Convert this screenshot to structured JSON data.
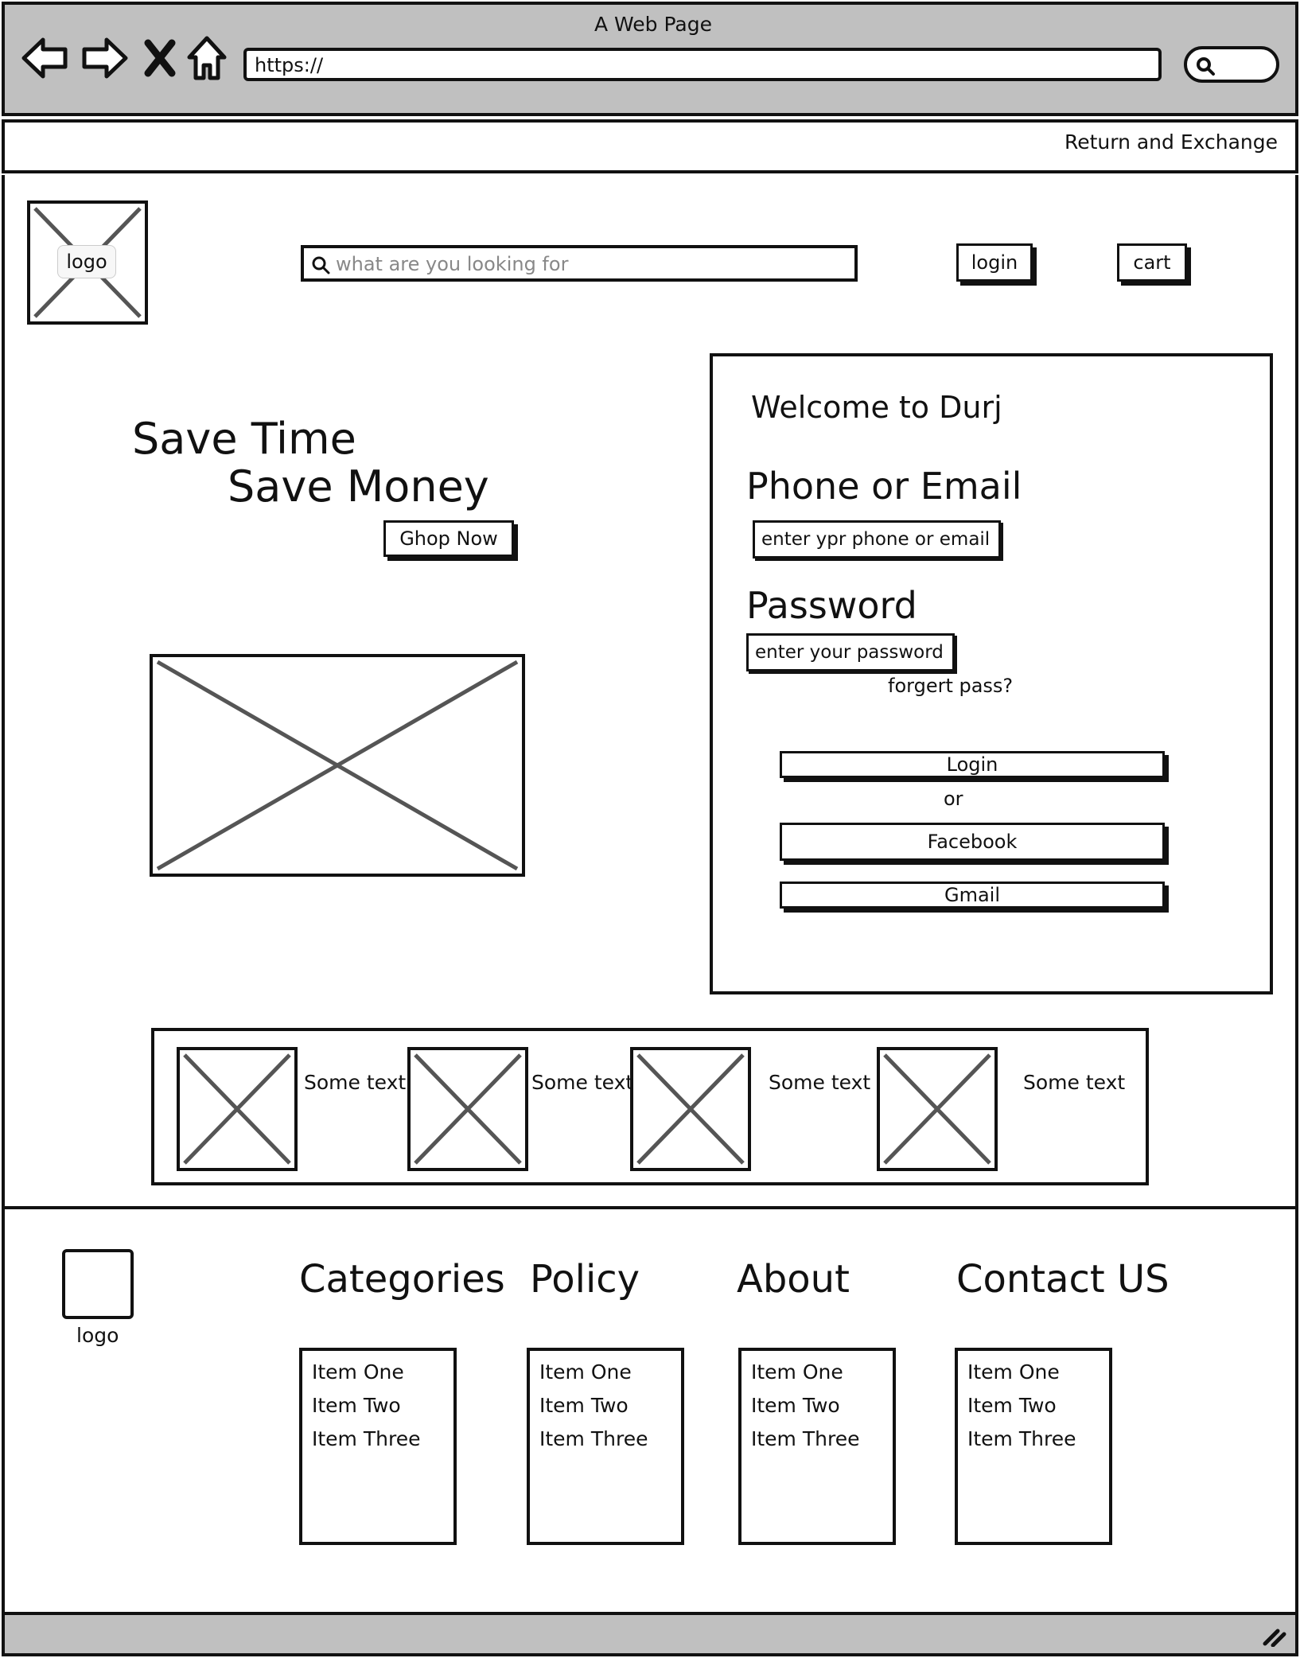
{
  "browser": {
    "window_title": "A Web Page",
    "url": "https://"
  },
  "topbar": {
    "return_link": "Return and Exchange"
  },
  "header": {
    "logo_label": "logo",
    "search_placeholder": "what are you looking for",
    "login_label": "login",
    "cart_label": "cart"
  },
  "hero": {
    "line1": "Save Time",
    "line2": "Save Money",
    "cta_label": "Ghop Now"
  },
  "login_panel": {
    "welcome": "Welcome to Durj",
    "phone_label": "Phone or Email",
    "phone_placeholder": "enter ypr phone or email",
    "password_label": "Password",
    "password_placeholder": "enter your password",
    "forgot_link": "forgert pass?",
    "login_button": "Login",
    "or_label": "or",
    "facebook_button": "Facebook",
    "gmail_button": "Gmail"
  },
  "features": [
    {
      "text": "Some text"
    },
    {
      "text": "Some text"
    },
    {
      "text": "Some text"
    },
    {
      "text": "Some text"
    }
  ],
  "footer": {
    "logo_label": "logo",
    "columns": [
      {
        "heading": "Categories",
        "items": [
          "Item One",
          "Item Two",
          "Item Three"
        ]
      },
      {
        "heading": "Policy",
        "items": [
          "Item One",
          "Item Two",
          "Item Three"
        ]
      },
      {
        "heading": "About",
        "items": [
          "Item One",
          "Item Two",
          "Item Three"
        ]
      },
      {
        "heading": "Contact US",
        "items": [
          "Item One",
          "Item Two",
          "Item Three"
        ]
      }
    ]
  },
  "icons": {
    "back": "arrow-left-icon",
    "forward": "arrow-right-icon",
    "stop": "close-icon",
    "home": "home-icon",
    "search": "search-icon",
    "resize": "resize-grip-icon"
  }
}
